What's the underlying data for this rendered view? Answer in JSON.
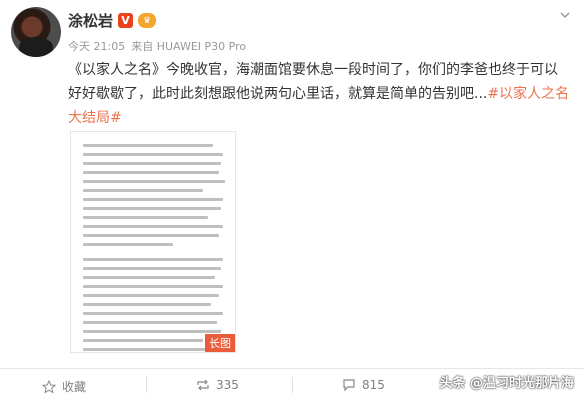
{
  "post": {
    "author": "涂松岩",
    "verified_badge": "V",
    "vip_badge": "会员",
    "time": "今天 21:05",
    "source": "来自 HUAWEI P30 Pro",
    "text_line1": "《以家人之名》今晚收官，海潮面馆要休息一段时间了，你们的李爸也终于可以",
    "text_line2": "好好歇歇了，此时此刻想跟他说两句心里话，就算是简单的告别吧...",
    "hashtag_part1": "#以家人之名",
    "hashtag_part2": "大结局#",
    "image_badge": "长图"
  },
  "actions": {
    "favorite_label": "收藏",
    "repost_count": "335",
    "comment_count": "815"
  },
  "watermark": "头条 @温习时光那片海",
  "icons": {
    "favorite": "star-icon",
    "repost": "repost-icon",
    "comment": "comment-icon",
    "menu": "chevron-down-icon"
  }
}
